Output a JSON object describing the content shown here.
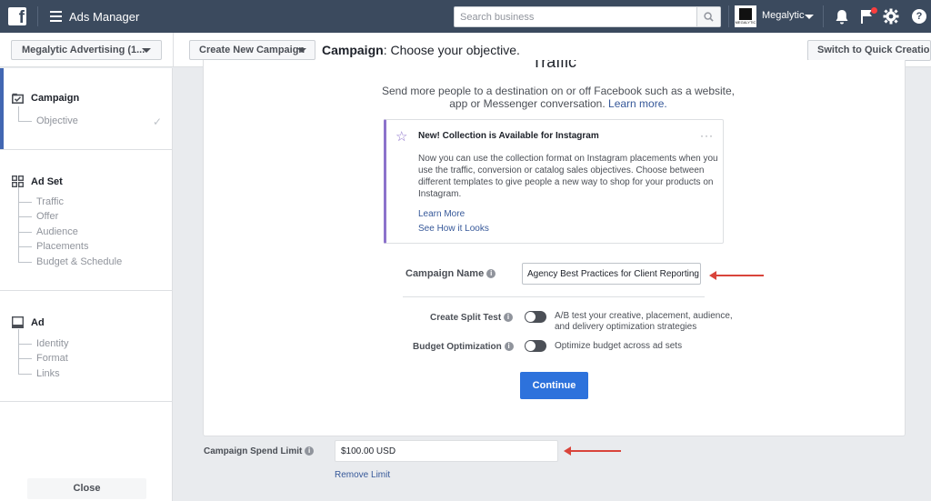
{
  "topbar": {
    "logo": "f",
    "app_title": "Ads Manager",
    "search_placeholder": "Search business",
    "account_logo_text": "MEGALYTIC",
    "account_name": "Megalytic",
    "help": "?"
  },
  "subheader": {
    "account_selector": "Megalytic Advertising (1...",
    "create_button": "Create New Campaign",
    "crumb_bold": "Campaign",
    "crumb_rest": ": Choose your objective.",
    "quick_button": "Switch to Quick Creation"
  },
  "sidebar": {
    "sections": [
      {
        "label": "Campaign",
        "items": [
          "Objective"
        ]
      },
      {
        "label": "Ad Set",
        "items": [
          "Traffic",
          "Offer",
          "Audience",
          "Placements",
          "Budget & Schedule"
        ]
      },
      {
        "label": "Ad",
        "items": [
          "Identity",
          "Format",
          "Links"
        ]
      }
    ],
    "close_label": "Close"
  },
  "main": {
    "title": "Traffic",
    "intro": "Send more people to a destination on or off Facebook such as a website, app or Messenger conversation.",
    "intro_link": "Learn more.",
    "notice": {
      "title": "New! Collection is Available for Instagram",
      "body": "Now you can use the collection format on Instagram placements when you use the traffic, conversion or catalog sales objectives. Choose between different templates to give people a new way to shop for your products on Instagram.",
      "link1": "Learn More",
      "link2": "See How it Looks",
      "more": "···"
    },
    "campaign_name_label": "Campaign Name",
    "campaign_name_value": "Agency Best Practices for Client Reporting",
    "split_test_label": "Create Split Test",
    "split_test_desc": "A/B test your creative, placement, audience, and delivery optimization strategies",
    "split_test_on": false,
    "budget_opt_label": "Budget Optimization",
    "budget_opt_desc": "Optimize budget across ad sets",
    "budget_opt_on": false,
    "continue_label": "Continue"
  },
  "spend": {
    "label": "Campaign Spend Limit",
    "value": "$100.00 USD",
    "remove_link": "Remove Limit"
  },
  "colors": {
    "topbar": "#3b4a5e",
    "primary_button": "#2d72dc",
    "active_bar": "#4267b2",
    "notice_accent": "#8c72cb",
    "annotation_arrow": "#d9443b"
  }
}
